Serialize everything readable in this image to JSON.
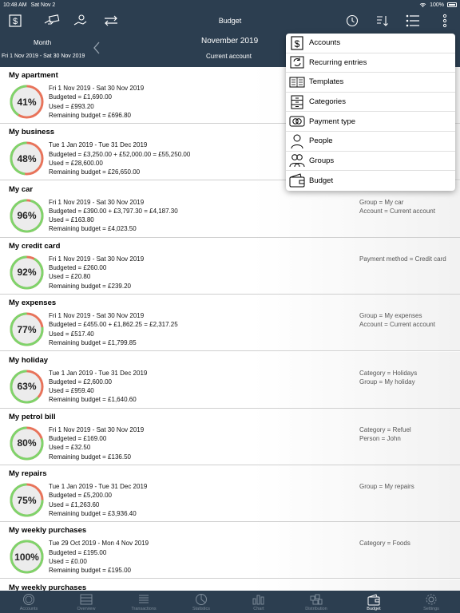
{
  "status_bar": {
    "time": "10:48 AM",
    "date": "Sat Nov 2",
    "battery": "100%"
  },
  "toolbar": {
    "title": "Budget"
  },
  "subheader": {
    "period_type": "Month",
    "date_range": "Fri 1 Nov 2019 - Sat 30 Nov 2019",
    "period": "November 2019",
    "account": "Current account"
  },
  "colors": {
    "bar_bg": "#2c3e50",
    "ring_green": "#7ed46b",
    "ring_red": "#e8735a",
    "ring_track": "#e6e6e6"
  },
  "budgets": [
    {
      "name": "My apartment",
      "percent": 0.41,
      "percent_label": "41%",
      "period": "Fri 1 Nov 2019 - Sat 30 Nov 2019",
      "budgeted": "Budgeted = £1,690.00",
      "used": "Used = £993.20",
      "remaining": "Remaining budget = £696.80",
      "filters": []
    },
    {
      "name": "My business",
      "percent": 0.48,
      "percent_label": "48%",
      "period": "Tue 1 Jan 2019 - Tue 31 Dec 2019",
      "budgeted": "Budgeted = £3,250.00 + £52,000.00 = £55,250.00",
      "used": "Used = £28,600.00",
      "remaining": "Remaining budget = £26,650.00",
      "filters": []
    },
    {
      "name": "My car",
      "percent": 0.96,
      "percent_label": "96%",
      "period": "Fri 1 Nov 2019 - Sat 30 Nov 2019",
      "budgeted": "Budgeted = £390.00 + £3,797.30 = £4,187.30",
      "used": "Used = £163.80",
      "remaining": "Remaining budget = £4,023.50",
      "filters": [
        "Group = My car",
        "Account = Current account"
      ]
    },
    {
      "name": "My credit card",
      "percent": 0.92,
      "percent_label": "92%",
      "period": "Fri 1 Nov 2019 - Sat 30 Nov 2019",
      "budgeted": "Budgeted = £260.00",
      "used": "Used = £20.80",
      "remaining": "Remaining budget = £239.20",
      "filters": [
        "Payment method = Credit card"
      ]
    },
    {
      "name": "My expenses",
      "percent": 0.77,
      "percent_label": "77%",
      "period": "Fri 1 Nov 2019 - Sat 30 Nov 2019",
      "budgeted": "Budgeted = £455.00 + £1,862.25 = £2,317.25",
      "used": "Used = £517.40",
      "remaining": "Remaining budget = £1,799.85",
      "filters": [
        "Group = My expenses",
        "Account = Current account"
      ]
    },
    {
      "name": "My holiday",
      "percent": 0.63,
      "percent_label": "63%",
      "period": "Tue 1 Jan 2019 - Tue 31 Dec 2019",
      "budgeted": "Budgeted = £2,600.00",
      "used": "Used = £959.40",
      "remaining": "Remaining budget = £1,640.60",
      "filters": [
        "Category = Holidays",
        "Group = My holiday"
      ]
    },
    {
      "name": "My petrol bill",
      "percent": 0.8,
      "percent_label": "80%",
      "period": "Fri 1 Nov 2019 - Sat 30 Nov 2019",
      "budgeted": "Budgeted = £169.00",
      "used": "Used = £32.50",
      "remaining": "Remaining budget = £136.50",
      "filters": [
        "Category = Refuel",
        "Person = John"
      ]
    },
    {
      "name": "My repairs",
      "percent": 0.75,
      "percent_label": "75%",
      "period": "Tue 1 Jan 2019 - Tue 31 Dec 2019",
      "budgeted": "Budgeted = £5,200.00",
      "used": "Used = £1,263.60",
      "remaining": "Remaining budget = £3,936.40",
      "filters": [
        "Group = My repairs"
      ]
    },
    {
      "name": "My weekly purchases",
      "percent": 1.0,
      "percent_label": "100%",
      "period": "Tue 29 Oct 2019 - Mon 4 Nov 2019",
      "budgeted": "Budgeted = £195.00",
      "used": "Used = £0.00",
      "remaining": "Remaining budget = £195.00",
      "filters": [
        "Category = Foods"
      ]
    },
    {
      "name": "My weekly purchases",
      "percent": 1.0,
      "percent_label": "",
      "period": "",
      "budgeted": "",
      "used": "",
      "remaining": "",
      "filters": []
    }
  ],
  "menu": {
    "items": [
      {
        "label": "Accounts",
        "icon": "dollar-square-icon"
      },
      {
        "label": "Recurring entries",
        "icon": "recurring-icon"
      },
      {
        "label": "Templates",
        "icon": "templates-icon"
      },
      {
        "label": "Categories",
        "icon": "categories-icon"
      },
      {
        "label": "Payment type",
        "icon": "payment-type-icon"
      },
      {
        "label": "People",
        "icon": "person-icon"
      },
      {
        "label": "Groups",
        "icon": "groups-icon"
      },
      {
        "label": "Budget",
        "icon": "wallet-icon"
      }
    ]
  },
  "tabs": [
    {
      "label": "Accounts",
      "icon": "coin-icon"
    },
    {
      "label": "Overview",
      "icon": "overview-icon"
    },
    {
      "label": "Transactions",
      "icon": "transactions-icon"
    },
    {
      "label": "Statistics",
      "icon": "statistics-icon"
    },
    {
      "label": "Chart",
      "icon": "chart-icon"
    },
    {
      "label": "Distribution",
      "icon": "distribution-icon"
    },
    {
      "label": "Budget",
      "icon": "budget-tab-icon",
      "active": true
    },
    {
      "label": "Settings",
      "icon": "settings-icon"
    }
  ]
}
